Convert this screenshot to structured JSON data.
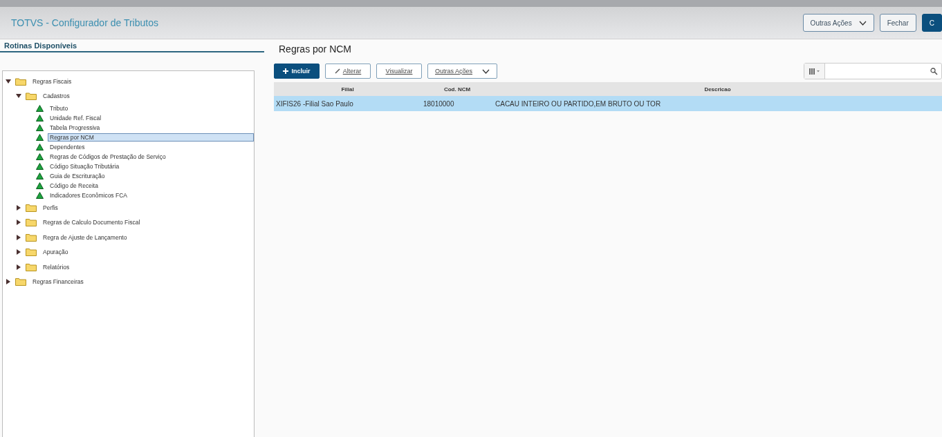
{
  "header": {
    "title": "TOTVS - Configurador de Tributos",
    "buttons": [
      {
        "label": "Outras Ações",
        "kind": "dropdown"
      },
      {
        "label": "Fechar",
        "kind": "plain"
      },
      {
        "label": "C",
        "kind": "primary"
      }
    ]
  },
  "sidebar": {
    "title": "Rotinas Disponíveis",
    "tree": [
      {
        "label": "Regras Fiscais",
        "kind": "folder",
        "expanded": true,
        "selected": false,
        "children": [
          {
            "label": "Cadastros",
            "kind": "folder",
            "expanded": true,
            "selected": false,
            "children": [
              {
                "label": "Tributo",
                "kind": "leaf",
                "selected": false
              },
              {
                "label": "Unidade Ref. Fiscal",
                "kind": "leaf",
                "selected": false
              },
              {
                "label": "Tabela Progressiva",
                "kind": "leaf",
                "selected": false
              },
              {
                "label": "Regras por NCM",
                "kind": "leaf",
                "selected": true
              },
              {
                "label": "Dependentes",
                "kind": "leaf",
                "selected": false
              },
              {
                "label": "Regras de Códigos de Prestação de Serviço",
                "kind": "leaf",
                "selected": false
              },
              {
                "label": "Código Situação Tributária",
                "kind": "leaf",
                "selected": false
              },
              {
                "label": "Guia de Escrituração",
                "kind": "leaf",
                "selected": false
              },
              {
                "label": "Código de Receita",
                "kind": "leaf",
                "selected": false
              },
              {
                "label": "Indicadores Econômicos FCA",
                "kind": "leaf",
                "selected": false
              }
            ]
          },
          {
            "label": "Perfis",
            "kind": "folder",
            "expanded": false,
            "selected": false
          },
          {
            "label": "Regras de Calculo Documento Fiscal",
            "kind": "folder",
            "expanded": false,
            "selected": false
          },
          {
            "label": "Regra de Ajuste de Lançamento",
            "kind": "folder",
            "expanded": false,
            "selected": false
          },
          {
            "label": "Apuração",
            "kind": "folder",
            "expanded": false,
            "selected": false
          },
          {
            "label": "Relatórios",
            "kind": "folder",
            "expanded": false,
            "selected": false
          }
        ]
      },
      {
        "label": "Regras Financeiras",
        "kind": "folder",
        "expanded": false,
        "selected": false
      }
    ]
  },
  "main": {
    "title": "Regras por NCM",
    "toolbar": [
      {
        "label": "Incluir",
        "kind": "primary"
      },
      {
        "label": "Alterar",
        "kind": "edit"
      },
      {
        "label": "Visualizar",
        "kind": "plain"
      },
      {
        "label": "Outras Ações",
        "kind": "dropdown"
      }
    ],
    "table": {
      "columns": [
        "Filial",
        "Cod. NCM",
        "Descricao"
      ],
      "rows": [
        {
          "cells": [
            "XIFIS26 -Filial Sao Paulo",
            "18010000",
            "CACAU INTEIRO OU PARTIDO,EM BRUTO OU TOR"
          ],
          "selected": true
        }
      ]
    }
  }
}
